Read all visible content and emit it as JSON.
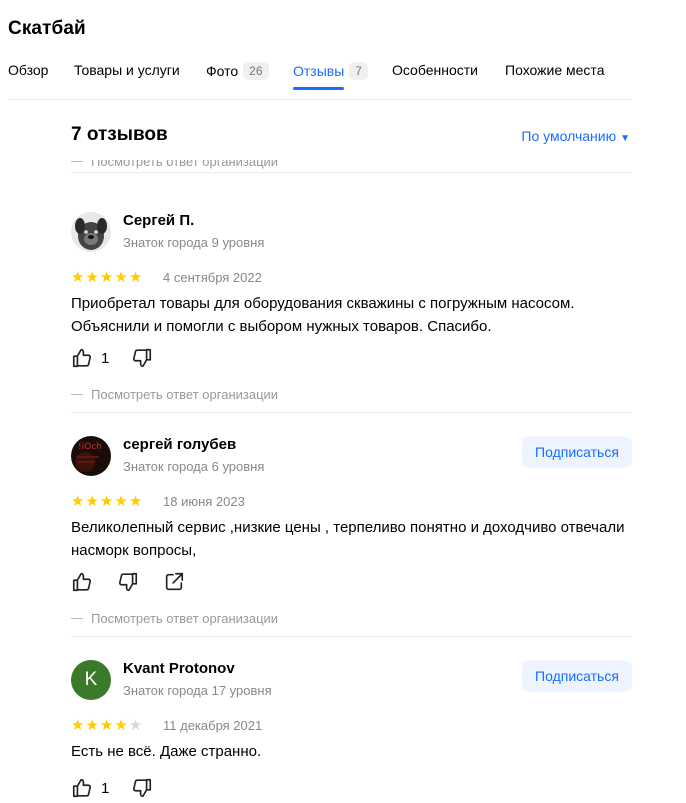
{
  "page": {
    "title": "Скатбай"
  },
  "tabs": [
    {
      "label": "Обзор",
      "count": ""
    },
    {
      "label": "Товары и услуги",
      "count": ""
    },
    {
      "label": "Фото",
      "count": "26"
    },
    {
      "label": "Отзывы",
      "count": "7"
    },
    {
      "label": "Особенности",
      "count": ""
    },
    {
      "label": "Похожие места",
      "count": ""
    }
  ],
  "active_tab": "Отзывы",
  "reviews_header": {
    "count_text": "7 отзывов",
    "sort_label": "По умолчанию"
  },
  "answer_link_text": "Посмотреть ответ организации",
  "colors": {
    "accent": "#196dff",
    "star": "#ffcc00",
    "muted": "#888888"
  },
  "reviews": [
    {
      "author": "Сергей П.",
      "level": "Знаток города 9 уровня",
      "rating": 5,
      "date": "4 сентября 2022",
      "text": "Приобретал товары для оборудования скважины с погружным насосом. Объяснили и помогли с выбором нужных товаров. Спасибо.",
      "likes": "1",
      "avatar": "dog-photo",
      "show_subscribe": false,
      "show_share": false
    },
    {
      "author": "сергей голубев",
      "level": "Знаток города 6 уровня",
      "rating": 5,
      "date": "18 июня 2023",
      "text": "Великолепный сервис ,низкие цены , терпеливо понятно и доходчиво отвечали насморк вопросы,",
      "likes": "",
      "avatar": "dark-photo",
      "show_subscribe": true,
      "show_share": true
    },
    {
      "author": "Kvant Protonov",
      "level": "Знаток города 17 уровня",
      "rating": 4,
      "date": "11 декабря 2021",
      "text": "Есть не всё. Даже странно.",
      "likes": "1",
      "avatar": "letter-K",
      "avatar_letter": "K",
      "show_subscribe": true,
      "show_share": false
    }
  ],
  "subscribe_label": "Подписаться"
}
